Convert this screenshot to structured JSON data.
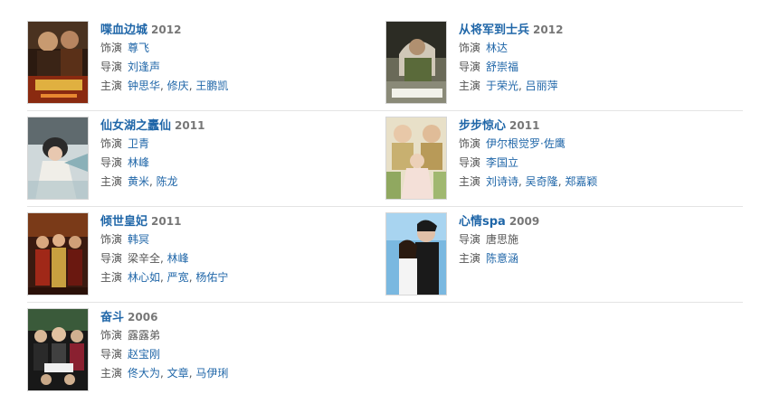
{
  "labels": {
    "role": "饰演",
    "director": "导演",
    "cast": "主演"
  },
  "movies": [
    {
      "title": "喋血边城",
      "year": "2012",
      "role": "尊飞",
      "director": [
        "刘逢声"
      ],
      "cast": [
        "钟思华",
        "修庆",
        "王鹏凯"
      ]
    },
    {
      "title": "从将军到士兵",
      "year": "2012",
      "role": "林达",
      "director": [
        "舒崇福"
      ],
      "cast": [
        "于荣光",
        "吕丽萍"
      ]
    },
    {
      "title": "仙女湖之蠹仙",
      "year": "2011",
      "role": "卫青",
      "director": [
        "林峰"
      ],
      "cast": [
        "黄米",
        "陈龙"
      ]
    },
    {
      "title": "步步惊心",
      "year": "2011",
      "role": "伊尔根觉罗·佐鹰",
      "director": [
        "李国立"
      ],
      "cast": [
        "刘诗诗",
        "吴奇隆",
        "郑嘉颖"
      ]
    },
    {
      "title": "倾世皇妃",
      "year": "2011",
      "role": "韩冥",
      "director": [
        "梁辛全",
        "林峰"
      ],
      "cast": [
        "林心如",
        "严宽",
        "杨佑宁"
      ]
    },
    {
      "title": "心情spa",
      "year": "2009",
      "role": "",
      "director": [
        "唐思施"
      ],
      "cast": [
        "陈意涵"
      ]
    },
    {
      "title": "奋斗",
      "year": "2006",
      "role": "露露弟",
      "director": [
        "赵宝刚"
      ],
      "cast": [
        "佟大为",
        "文章",
        "马伊琍"
      ]
    }
  ],
  "colors": {
    "link": "#1f66a8",
    "year": "#777777",
    "label": "#555555",
    "divider": "#e4e4e4"
  }
}
